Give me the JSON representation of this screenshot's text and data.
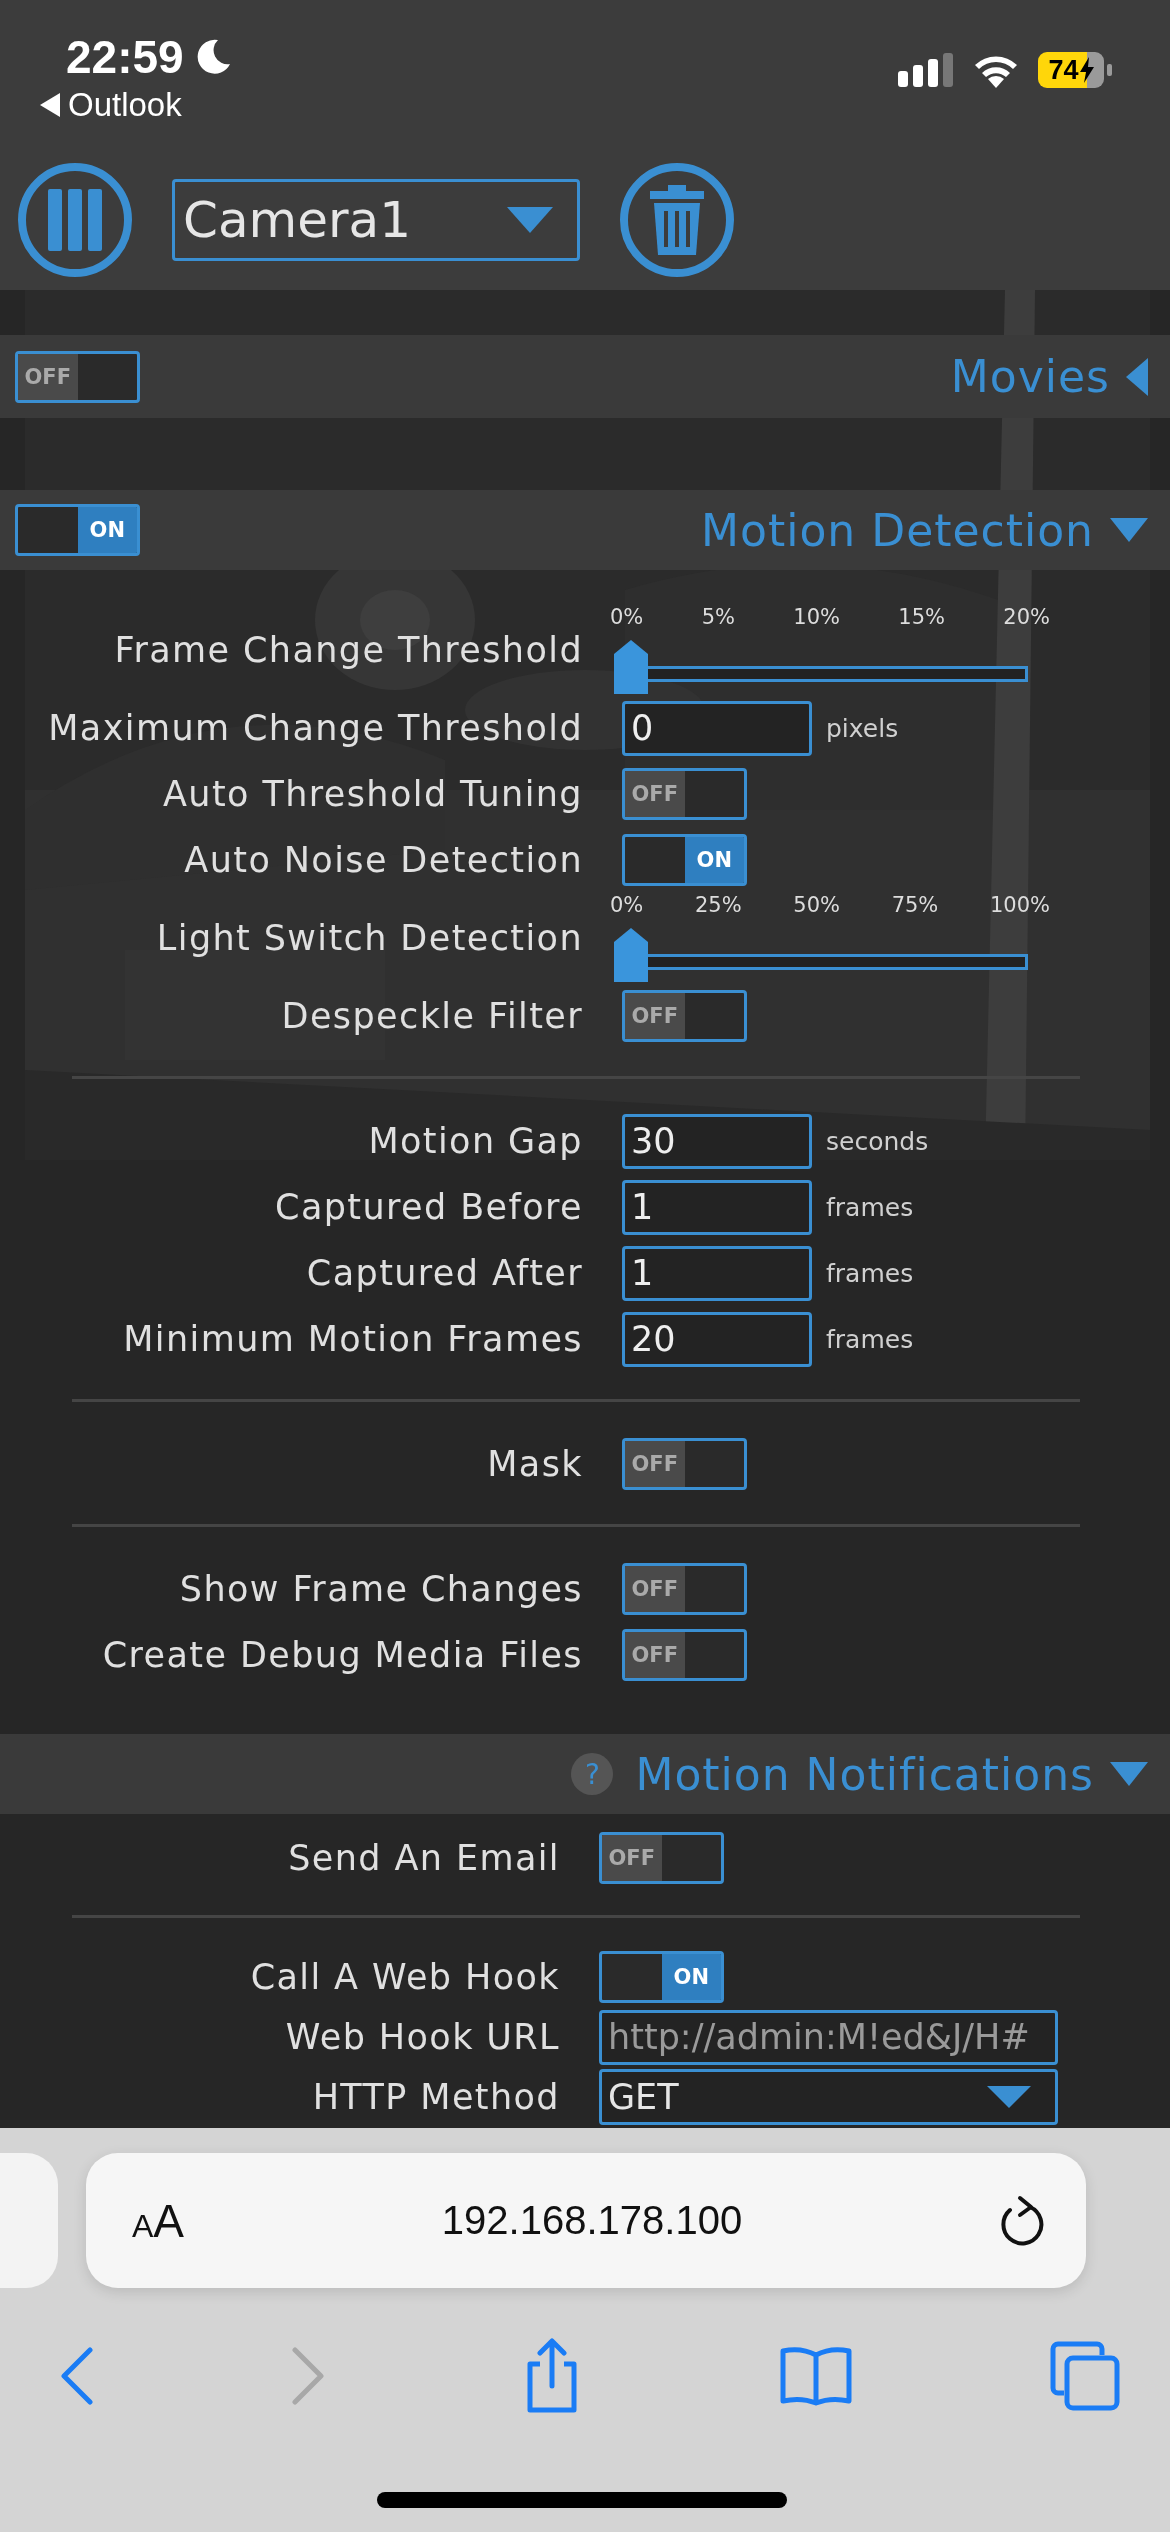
{
  "status_bar": {
    "time": "22:59",
    "back_app": "Outlook",
    "battery": "74"
  },
  "toolbar": {
    "camera_select": {
      "value": "Camera1"
    }
  },
  "sections": [
    {
      "title": "Movies",
      "expanded": false,
      "toggle": {
        "on": false,
        "label": "OFF"
      }
    },
    {
      "title": "Motion Detection",
      "expanded": true,
      "toggle": {
        "on": true,
        "label": "ON"
      },
      "groups": [
        [
          {
            "kind": "slider",
            "label": "Frame Change Threshold",
            "ticks": [
              "0%",
              "5%",
              "10%",
              "15%",
              "20%"
            ],
            "level": 0
          },
          {
            "kind": "number",
            "label": "Maximum Change Threshold",
            "value": "0",
            "unit": "pixels"
          },
          {
            "kind": "toggle",
            "label": "Auto Threshold Tuning",
            "on": false,
            "text": "OFF"
          },
          {
            "kind": "toggle",
            "label": "Auto Noise Detection",
            "on": true,
            "text": "ON"
          },
          {
            "kind": "slider",
            "label": "Light Switch Detection",
            "ticks": [
              "0%",
              "25%",
              "50%",
              "75%",
              "100%"
            ],
            "level": 0
          },
          {
            "kind": "toggle",
            "label": "Despeckle Filter",
            "on": false,
            "text": "OFF"
          }
        ],
        [
          {
            "kind": "number",
            "label": "Motion Gap",
            "value": "30",
            "unit": "seconds"
          },
          {
            "kind": "number",
            "label": "Captured Before",
            "value": "1",
            "unit": "frames"
          },
          {
            "kind": "number",
            "label": "Captured After",
            "value": "1",
            "unit": "frames"
          },
          {
            "kind": "number",
            "label": "Minimum Motion Frames",
            "value": "20",
            "unit": "frames"
          }
        ],
        [
          {
            "kind": "toggle",
            "label": "Mask",
            "on": false,
            "text": "OFF"
          }
        ],
        [
          {
            "kind": "toggle",
            "label": "Show Frame Changes",
            "on": false,
            "text": "OFF"
          },
          {
            "kind": "toggle",
            "label": "Create Debug Media Files",
            "on": false,
            "text": "OFF"
          }
        ]
      ]
    },
    {
      "title": "Motion Notifications",
      "expanded": true,
      "help": "?",
      "groups": [
        [
          {
            "kind": "toggle",
            "label": "Send An Email",
            "on": false,
            "text": "OFF"
          }
        ],
        [
          {
            "kind": "toggle",
            "label": "Call A Web Hook",
            "on": true,
            "text": "ON"
          },
          {
            "kind": "text",
            "label": "Web Hook URL",
            "value": "http://admin:M!ed&J/H#"
          },
          {
            "kind": "select",
            "label": "HTTP Method",
            "value": "GET"
          }
        ]
      ]
    }
  ],
  "browser": {
    "text_size": [
      "A",
      "A"
    ],
    "url": "192.168.178.100",
    "back_disabled": false,
    "forward_disabled": true
  }
}
